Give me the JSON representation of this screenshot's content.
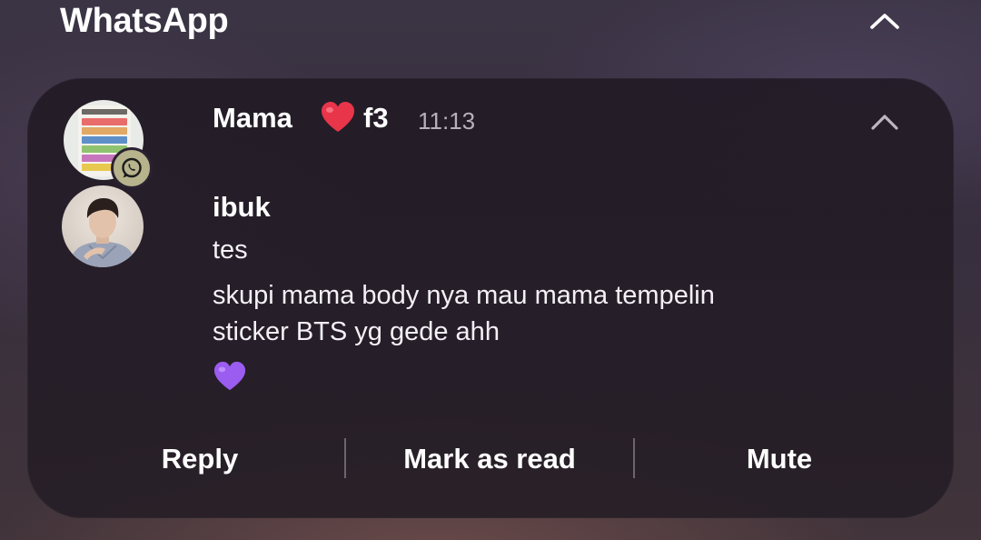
{
  "app": {
    "title": "WhatsApp"
  },
  "notification": {
    "group_name": "Mama",
    "group_name_emoji": "red-heart",
    "group_name_suffix": "f3",
    "time": "11:13",
    "sender": "ibuk",
    "messages": [
      "tes",
      "skupi mama body nya mau mama tempelin",
      "sticker BTS yg gede ahh"
    ],
    "last_message_emoji": "purple-heart",
    "group_avatar_icon": "house-rules-poster",
    "app_badge_icon": "whatsapp-icon"
  },
  "actions": {
    "reply": "Reply",
    "mark_as_read": "Mark as read",
    "mute": "Mute"
  },
  "colors": {
    "card_background": "#241c27",
    "text_primary": "#ffffff",
    "text_secondary": "#b7b0bd",
    "badge": "#b6b38d",
    "heart_red": "#e8354a",
    "heart_purple": "#9b5cf0"
  }
}
